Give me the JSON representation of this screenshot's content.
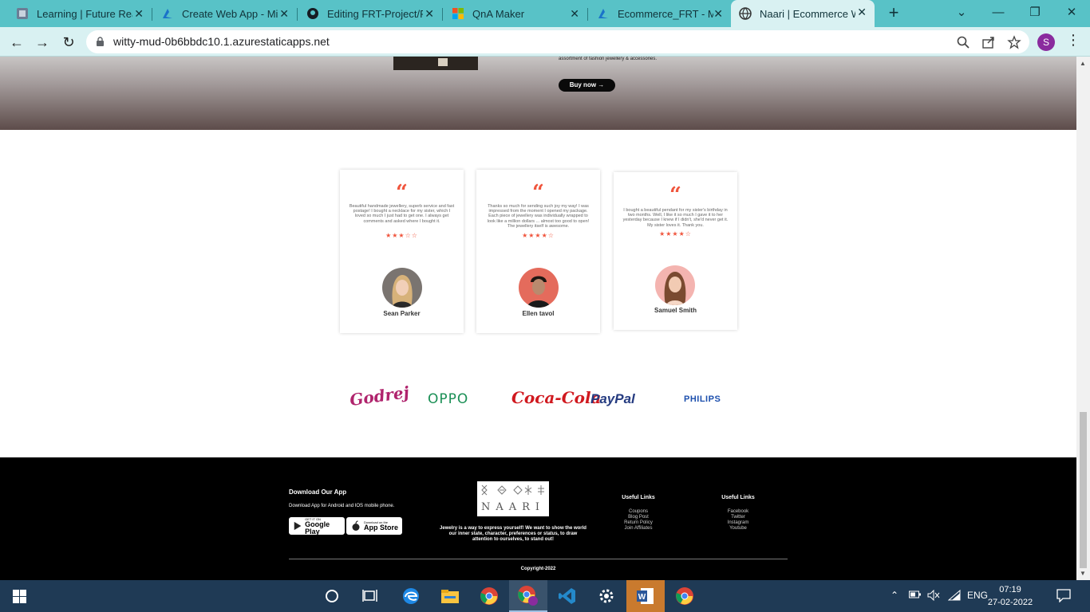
{
  "browser": {
    "tabs": [
      {
        "label": "Learning | Future Read",
        "icon": "learning-favicon",
        "active": false
      },
      {
        "label": "Create Web App - Mic",
        "icon": "azure-favicon",
        "active": false
      },
      {
        "label": "Editing FRT-Project/RE",
        "icon": "github-favicon",
        "active": false
      },
      {
        "label": "QnA Maker",
        "icon": "microsoft-favicon",
        "active": false
      },
      {
        "label": "Ecommerce_FRT - Mic",
        "icon": "azure-favicon",
        "active": false
      },
      {
        "label": "Naari | Ecommerce We",
        "icon": "globe-favicon",
        "active": true
      }
    ],
    "url": "witty-mud-0b6bbdc10.1.azurestaticapps.net",
    "profile_initial": "S"
  },
  "hero": {
    "tagline": "assortment of fashion jewellery & accessories.",
    "buy_label": "Buy now →"
  },
  "testimonials": [
    {
      "quote_mark": "“",
      "text": "Beautiful handmade jewellery, superb service and fast postage! I bought a necklace for my sister, which I loved so much I just had to get one. I always get comments and asked where I bought it.",
      "stars": "★★★☆☆",
      "name": "Sean Parker",
      "rating": 3
    },
    {
      "quote_mark": "“",
      "text": "Thanks so much for sending such joy my way! I was impressed from the moment I opened my package. Each piece of jewellery was individually wrapped to look like a million dollars ... almost too good to open! The jewellery itself is awesome.",
      "stars": "★★★★☆",
      "name": "Ellen tavol",
      "rating": 4
    },
    {
      "quote_mark": "“",
      "text": "I bought a beautiful pendant for my sister's birthday in two months. Well, I like it so much I gave it to her yesterday because I knew if I didn't, she'd never get it. My sister loves it. Thank you.",
      "stars": "★★★★☆",
      "name": "Samuel Smith",
      "rating": 4
    }
  ],
  "brands": [
    "Godrej",
    "OPPO",
    "Coca-Cola",
    "PayPal",
    "PHILIPS"
  ],
  "footer": {
    "download_title": "Download Our App",
    "download_sub": "Download App for Android and IOS mobile phone.",
    "google_play_small": "GET IT ON",
    "google_play_big": "Google Play",
    "app_store_small": "Download on the",
    "app_store_big": "App Store",
    "logo_text": "NAARI",
    "about": "Jewelry is a way to express yourself! We want to show the world our inner state, character, preferences or status, to draw attention to ourselves, to stand out!",
    "links_col1": {
      "title": "Useful Links",
      "items": [
        "Coupons",
        "Blog Post",
        "Return Policy",
        "Join Affiliates"
      ]
    },
    "links_col2": {
      "title": "Useful Links",
      "items": [
        "Facebook",
        "Twitter",
        "Instagram",
        "Youtube"
      ]
    },
    "copyright": "Copyright-2022"
  },
  "taskbar": {
    "time": "07:19",
    "date": "27-02-2022",
    "lang": "ENG"
  },
  "colors": {
    "accent": "#f0553d",
    "tabbar": "#58c2c7",
    "footer_bg": "#000000"
  }
}
